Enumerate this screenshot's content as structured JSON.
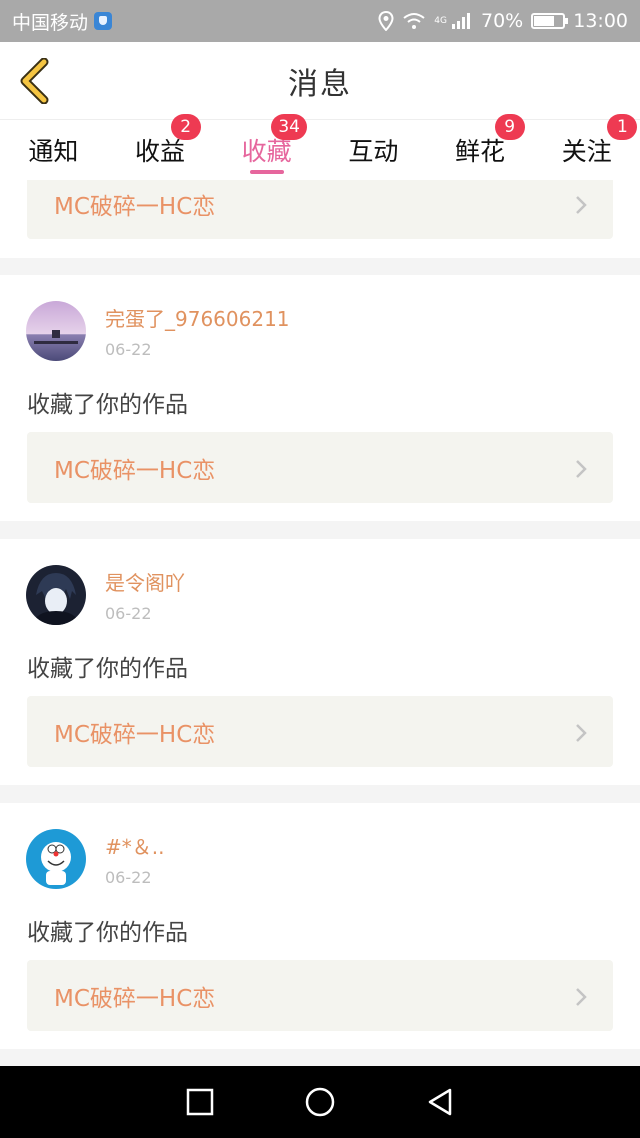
{
  "status_bar": {
    "carrier": "中国移动",
    "network": "4G",
    "battery": "70%",
    "battery_level": 0.7,
    "time": "13:00"
  },
  "header": {
    "title": "消息",
    "back_icon": "chevron-left-icon"
  },
  "tabs": [
    {
      "label": "通知",
      "badge": ""
    },
    {
      "label": "收益",
      "badge": "2"
    },
    {
      "label": "收藏",
      "badge": "34",
      "active": true
    },
    {
      "label": "互动",
      "badge": ""
    },
    {
      "label": "鲜花",
      "badge": "9"
    },
    {
      "label": "关注",
      "badge": "1"
    }
  ],
  "feed": {
    "partial_card": {
      "work_title": "MC破碎一HC恋"
    },
    "items": [
      {
        "user": "完蛋了_976606211",
        "date": "06-22",
        "action": "收藏了你的作品",
        "work_title": "MC破碎一HC恋",
        "avatar_icon": "avatar-sunset-photo"
      },
      {
        "user": "是令阁吖",
        "date": "06-22",
        "action": "收藏了你的作品",
        "work_title": "MC破碎一HC恋",
        "avatar_icon": "avatar-anime-character"
      },
      {
        "user": "#*＆..",
        "date": "06-22",
        "action": "收藏了你的作品",
        "work_title": "MC破碎一HC恋",
        "avatar_icon": "avatar-doraemon"
      }
    ]
  },
  "colors": {
    "accent_pink": "#e6669d",
    "badge_red": "#ee3a52",
    "username_orange": "#e0925f",
    "work_title_orange": "#e99266"
  }
}
